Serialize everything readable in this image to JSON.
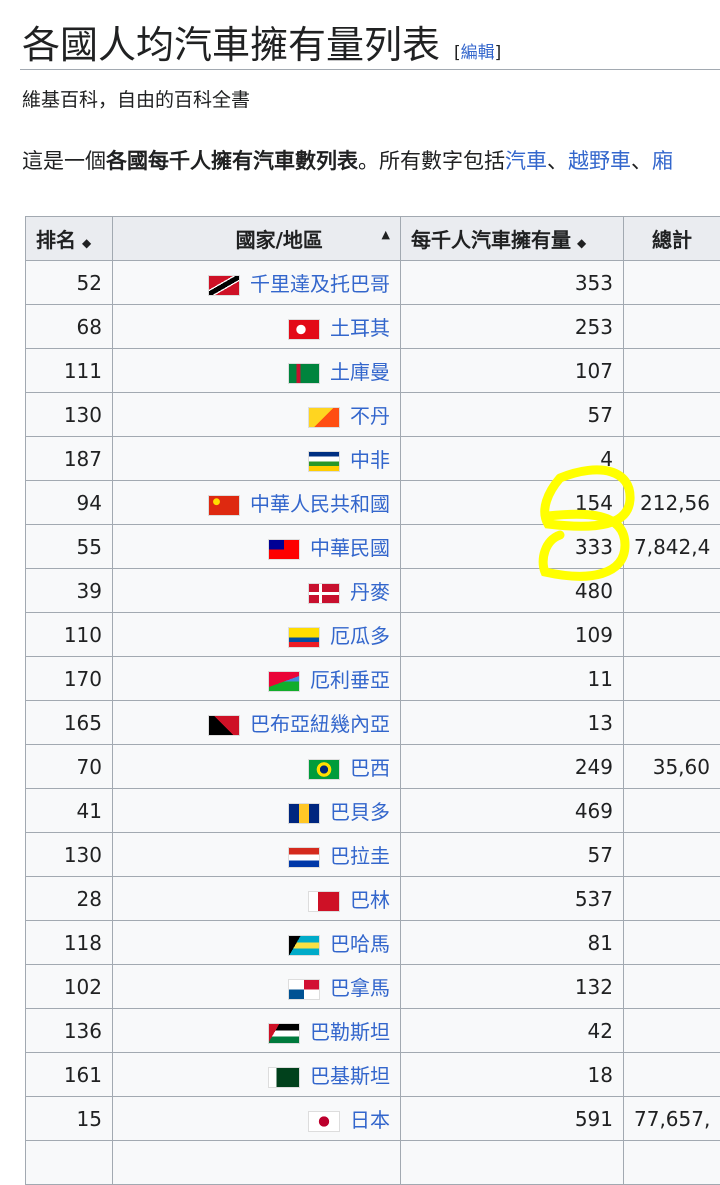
{
  "title": "各國人均汽車擁有量列表",
  "edit_label": "編輯",
  "tagline": "維基百科，自由的百科全書",
  "intro": {
    "p1": "這是一個",
    "bold": "各國每千人擁有汽車數列表",
    "p2": "。所有數字包括",
    "link1": "汽車",
    "sep1": "、",
    "link2": "越野車",
    "sep2": "、",
    "link3": "廂"
  },
  "headers": {
    "rank": "排名",
    "country": "國家/地區",
    "per1000": "每千人汽車擁有量",
    "total": "總計"
  },
  "rows": [
    {
      "rank": "52",
      "country": "千里達及托巴哥",
      "per1000": "353",
      "total": "",
      "flag": "tt"
    },
    {
      "rank": "68",
      "country": "土耳其",
      "per1000": "253",
      "total": "",
      "flag": "tr"
    },
    {
      "rank": "111",
      "country": "土庫曼",
      "per1000": "107",
      "total": "",
      "flag": "tm"
    },
    {
      "rank": "130",
      "country": "不丹",
      "per1000": "57",
      "total": "",
      "flag": "bt"
    },
    {
      "rank": "187",
      "country": "中非",
      "per1000": "4",
      "total": "",
      "flag": "cf"
    },
    {
      "rank": "94",
      "country": "中華人民共和國",
      "per1000": "154",
      "total": "212,56",
      "flag": "cn"
    },
    {
      "rank": "55",
      "country": "中華民國",
      "per1000": "333",
      "total": "7,842,4",
      "flag": "tw"
    },
    {
      "rank": "39",
      "country": "丹麥",
      "per1000": "480",
      "total": "",
      "flag": "dk"
    },
    {
      "rank": "110",
      "country": "厄瓜多",
      "per1000": "109",
      "total": "",
      "flag": "ec"
    },
    {
      "rank": "170",
      "country": "厄利垂亞",
      "per1000": "11",
      "total": "",
      "flag": "er"
    },
    {
      "rank": "165",
      "country": "巴布亞紐幾內亞",
      "per1000": "13",
      "total": "",
      "flag": "pg"
    },
    {
      "rank": "70",
      "country": "巴西",
      "per1000": "249",
      "total": "35,60",
      "flag": "br"
    },
    {
      "rank": "41",
      "country": "巴貝多",
      "per1000": "469",
      "total": "",
      "flag": "bb"
    },
    {
      "rank": "130",
      "country": "巴拉圭",
      "per1000": "57",
      "total": "",
      "flag": "py"
    },
    {
      "rank": "28",
      "country": "巴林",
      "per1000": "537",
      "total": "",
      "flag": "bh"
    },
    {
      "rank": "118",
      "country": "巴哈馬",
      "per1000": "81",
      "total": "",
      "flag": "bs"
    },
    {
      "rank": "102",
      "country": "巴拿馬",
      "per1000": "132",
      "total": "",
      "flag": "pa"
    },
    {
      "rank": "136",
      "country": "巴勒斯坦",
      "per1000": "42",
      "total": "",
      "flag": "ps"
    },
    {
      "rank": "161",
      "country": "巴基斯坦",
      "per1000": "18",
      "total": "",
      "flag": "pk"
    },
    {
      "rank": "15",
      "country": "日本",
      "per1000": "591",
      "total": "77,657,",
      "flag": "jp"
    },
    {
      "rank": "",
      "country": "",
      "per1000": "",
      "total": "",
      "flag": ""
    }
  ],
  "highlight_color": "#ffff00"
}
